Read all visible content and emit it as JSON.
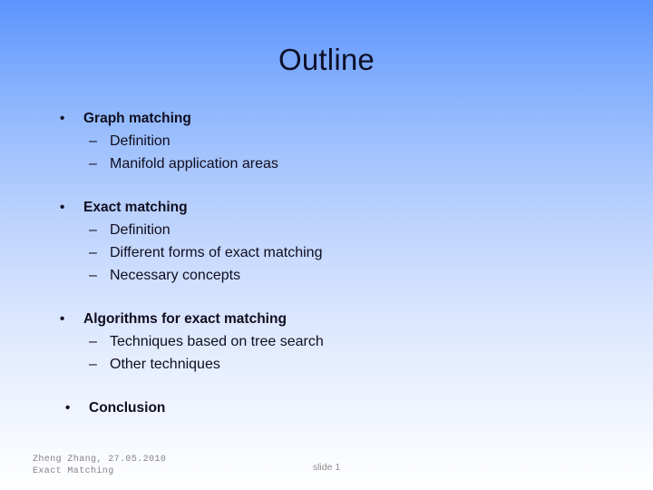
{
  "slide": {
    "title": "Outline",
    "groups": [
      {
        "bullet": "•",
        "heading": "Graph matching",
        "sub_marker": "–",
        "subitems": [
          "Definition",
          "Manifold application areas"
        ]
      },
      {
        "bullet": "•",
        "heading": "Exact matching",
        "sub_marker": "–",
        "subitems": [
          "Definition",
          "Different forms of exact matching",
          "Necessary concepts"
        ]
      },
      {
        "bullet": "•",
        "heading": "Algorithms for exact matching",
        "sub_marker": "–",
        "subitems": [
          "Techniques based on tree search",
          "Other techniques"
        ]
      },
      {
        "bullet": "•",
        "heading": "Conclusion",
        "sub_marker": "–",
        "subitems": []
      }
    ],
    "footer": {
      "author_line": "Zheng Zhang, 27.05.2010",
      "topic_line": "Exact Matching",
      "slide_number": "slide 1"
    },
    "colors": {
      "gradient_top": "#5d94fd",
      "gradient_bottom": "#ffffff",
      "text": "#100d1f",
      "title": "#0d1028",
      "footer_text": "#848484"
    }
  }
}
